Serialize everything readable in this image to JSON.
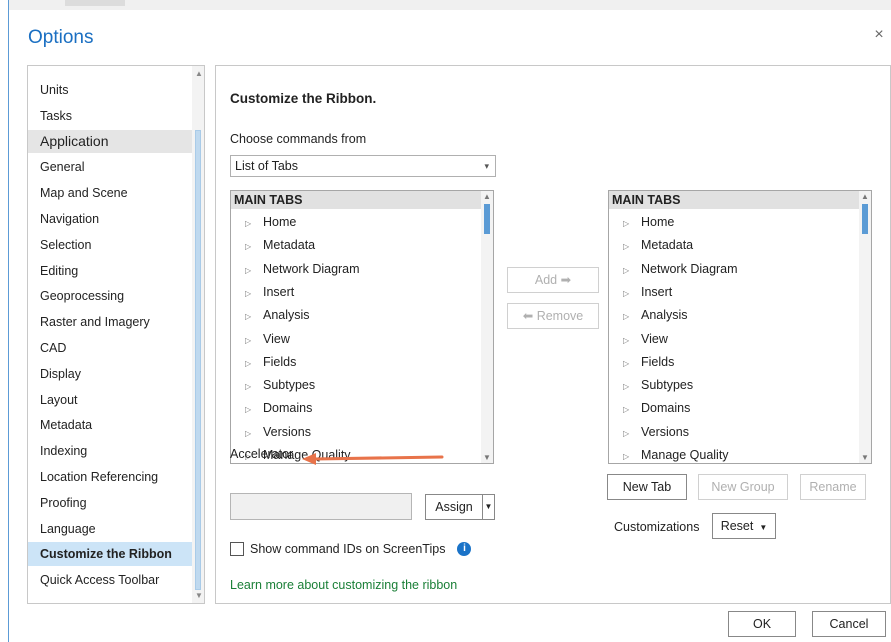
{
  "window": {
    "title": "Options"
  },
  "nav": {
    "items": [
      {
        "label": "Units",
        "type": "item"
      },
      {
        "label": "Tasks",
        "type": "item"
      },
      {
        "label": "Application",
        "type": "header"
      },
      {
        "label": "General",
        "type": "item"
      },
      {
        "label": "Map and Scene",
        "type": "item"
      },
      {
        "label": "Navigation",
        "type": "item"
      },
      {
        "label": "Selection",
        "type": "item"
      },
      {
        "label": "Editing",
        "type": "item"
      },
      {
        "label": "Geoprocessing",
        "type": "item"
      },
      {
        "label": "Raster and Imagery",
        "type": "item"
      },
      {
        "label": "CAD",
        "type": "item"
      },
      {
        "label": "Display",
        "type": "item"
      },
      {
        "label": "Layout",
        "type": "item"
      },
      {
        "label": "Metadata",
        "type": "item"
      },
      {
        "label": "Indexing",
        "type": "item"
      },
      {
        "label": "Location Referencing",
        "type": "item"
      },
      {
        "label": "Proofing",
        "type": "item"
      },
      {
        "label": "Language",
        "type": "item"
      },
      {
        "label": "Customize the Ribbon",
        "type": "active"
      },
      {
        "label": "Quick Access Toolbar",
        "type": "item"
      }
    ]
  },
  "main": {
    "heading": "Customize the Ribbon.",
    "choose_label": "Choose commands from",
    "choose_value": "List of Tabs",
    "left_list": {
      "header": "MAIN TABS",
      "items": [
        "Home",
        "Metadata",
        "Network Diagram",
        "Insert",
        "Analysis",
        "View",
        "Fields",
        "Subtypes",
        "Domains",
        "Versions",
        "Manage Quality"
      ]
    },
    "right_list": {
      "header": "MAIN TABS",
      "items": [
        "Home",
        "Metadata",
        "Network Diagram",
        "Insert",
        "Analysis",
        "View",
        "Fields",
        "Subtypes",
        "Domains",
        "Versions",
        "Manage Quality"
      ]
    },
    "add_label": "Add ➡",
    "remove_label": "⬅ Remove",
    "accelerator_label": "Accelerator",
    "accelerator_value": "",
    "assign_label": "Assign",
    "show_ids_label": "Show command IDs on ScreenTips",
    "learn_more": "Learn more about customizing the ribbon",
    "new_tab": "New Tab",
    "new_group": "New Group",
    "rename": "Rename",
    "customizations_label": "Customizations",
    "reset_label": "Reset"
  },
  "footer": {
    "ok": "OK",
    "cancel": "Cancel"
  },
  "colors": {
    "accent": "#1a6fc2",
    "nav_selected": "#cce4f7",
    "link": "#1a7f37",
    "arrow": "#e8734a"
  }
}
